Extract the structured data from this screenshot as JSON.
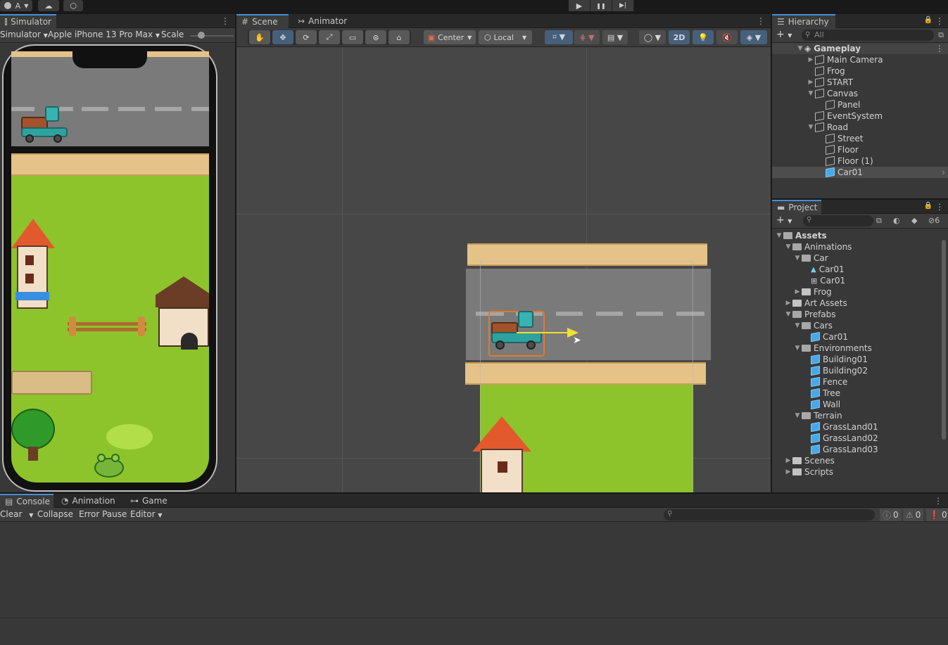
{
  "topbar": {
    "account_initial": "A",
    "play": "▶",
    "pause": "❚❚",
    "step": "▶|"
  },
  "simulator": {
    "tab": "Simulator",
    "mode_dropdown": "Simulator",
    "device_dropdown": "Apple iPhone 13 Pro Max",
    "scale_label": "Scale"
  },
  "scene": {
    "tabs": [
      "Scene",
      "Animator"
    ],
    "toolbar": {
      "pivot": "Center",
      "space": "Local",
      "mode2d": "2D"
    }
  },
  "hierarchy": {
    "tab": "Hierarchy",
    "search_placeholder": "All",
    "items": [
      {
        "label": "Gameplay",
        "depth": 0,
        "arrow": "down",
        "icon": "unity-scene-icon",
        "bold": true,
        "selected": false
      },
      {
        "label": "Main Camera",
        "depth": 1,
        "arrow": "right",
        "icon": "gameobject-icon"
      },
      {
        "label": "Frog",
        "depth": 1,
        "arrow": "",
        "icon": "gameobject-icon"
      },
      {
        "label": "START",
        "depth": 1,
        "arrow": "right",
        "icon": "gameobject-icon"
      },
      {
        "label": "Canvas",
        "depth": 1,
        "arrow": "down",
        "icon": "gameobject-icon"
      },
      {
        "label": "Panel",
        "depth": 2,
        "arrow": "",
        "icon": "gameobject-icon"
      },
      {
        "label": "EventSystem",
        "depth": 1,
        "arrow": "",
        "icon": "gameobject-icon"
      },
      {
        "label": "Road",
        "depth": 1,
        "arrow": "down",
        "icon": "gameobject-icon"
      },
      {
        "label": "Street",
        "depth": 2,
        "arrow": "",
        "icon": "gameobject-icon"
      },
      {
        "label": "Floor",
        "depth": 2,
        "arrow": "",
        "icon": "gameobject-icon"
      },
      {
        "label": "Floor (1)",
        "depth": 2,
        "arrow": "",
        "icon": "gameobject-icon"
      },
      {
        "label": "Car01",
        "depth": 2,
        "arrow": "",
        "icon": "prefab-icon",
        "selected": true
      }
    ]
  },
  "project": {
    "tab": "Project",
    "hidden_count": "6",
    "items": [
      {
        "label": "Assets",
        "depth": 0,
        "arrow": "down",
        "icon": "folder-open-icon",
        "bold": true
      },
      {
        "label": "Animations",
        "depth": 1,
        "arrow": "down",
        "icon": "folder-open-icon"
      },
      {
        "label": "Car",
        "depth": 2,
        "arrow": "down",
        "icon": "folder-open-icon"
      },
      {
        "label": "Car01",
        "depth": 3,
        "arrow": "",
        "icon": "animation-clip-icon"
      },
      {
        "label": "Car01",
        "depth": 3,
        "arrow": "",
        "icon": "animator-controller-icon"
      },
      {
        "label": "Frog",
        "depth": 2,
        "arrow": "right",
        "icon": "folder-icon"
      },
      {
        "label": "Art Assets",
        "depth": 1,
        "arrow": "right",
        "icon": "folder-icon"
      },
      {
        "label": "Prefabs",
        "depth": 1,
        "arrow": "down",
        "icon": "folder-open-icon"
      },
      {
        "label": "Cars",
        "depth": 2,
        "arrow": "down",
        "icon": "folder-open-icon"
      },
      {
        "label": "Car01",
        "depth": 3,
        "arrow": "",
        "icon": "prefab-icon"
      },
      {
        "label": "Environments",
        "depth": 2,
        "arrow": "down",
        "icon": "folder-open-icon"
      },
      {
        "label": "Building01",
        "depth": 3,
        "arrow": "",
        "icon": "prefab-icon"
      },
      {
        "label": "Building02",
        "depth": 3,
        "arrow": "",
        "icon": "prefab-icon"
      },
      {
        "label": "Fence",
        "depth": 3,
        "arrow": "",
        "icon": "prefab-icon"
      },
      {
        "label": "Tree",
        "depth": 3,
        "arrow": "",
        "icon": "prefab-icon"
      },
      {
        "label": "Wall",
        "depth": 3,
        "arrow": "",
        "icon": "prefab-icon"
      },
      {
        "label": "Terrain",
        "depth": 2,
        "arrow": "down",
        "icon": "folder-open-icon"
      },
      {
        "label": "GrassLand01",
        "depth": 3,
        "arrow": "",
        "icon": "prefab-icon"
      },
      {
        "label": "GrassLand02",
        "depth": 3,
        "arrow": "",
        "icon": "prefab-icon"
      },
      {
        "label": "GrassLand03",
        "depth": 3,
        "arrow": "",
        "icon": "prefab-icon"
      },
      {
        "label": "Scenes",
        "depth": 1,
        "arrow": "right",
        "icon": "folder-icon"
      },
      {
        "label": "Scripts",
        "depth": 1,
        "arrow": "right",
        "icon": "folder-icon"
      }
    ]
  },
  "console": {
    "tabs": [
      "Console",
      "Animation",
      "Game"
    ],
    "clear": "Clear",
    "collapse": "Collapse",
    "error_pause": "Error Pause",
    "editor": "Editor",
    "log_count": "0",
    "warning_count": "0",
    "error_count": "0"
  },
  "colors": {
    "grass": "#8dc42c",
    "road": "#7a7a7a",
    "sidewalk": "#e5c288",
    "selection_accent": "#4a8cd8",
    "move_gizmo": "#f0e030"
  }
}
